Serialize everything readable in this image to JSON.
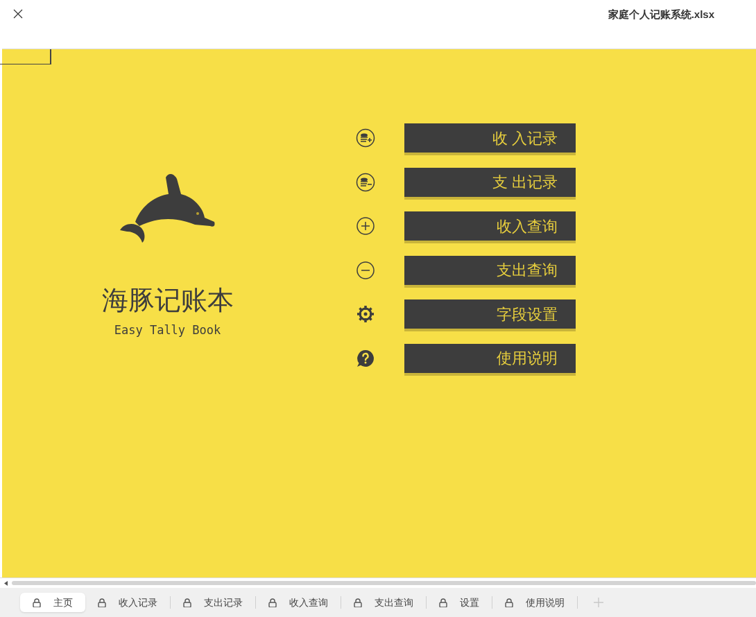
{
  "window": {
    "title": "家庭个人记账系统.xlsx"
  },
  "brand": {
    "title": "海豚记账本",
    "subtitle": "Easy Tally Book"
  },
  "menu": [
    {
      "kind": "income-record",
      "label": "收 入记录"
    },
    {
      "kind": "expense-record",
      "label": "支 出记录"
    },
    {
      "kind": "income-query",
      "label": "收入查询"
    },
    {
      "kind": "expense-query",
      "label": "支出查询"
    },
    {
      "kind": "settings",
      "label": "字段设置"
    },
    {
      "kind": "help",
      "label": "使用说明"
    }
  ],
  "sheet_tabs": [
    {
      "label": "主页",
      "selected": true
    },
    {
      "label": "收入记录",
      "selected": false
    },
    {
      "label": "支出记录",
      "selected": false
    },
    {
      "label": "收入查询",
      "selected": false
    },
    {
      "label": "支出查询",
      "selected": false
    },
    {
      "label": "设置",
      "selected": false
    },
    {
      "label": "使用说明",
      "selected": false
    }
  ]
}
